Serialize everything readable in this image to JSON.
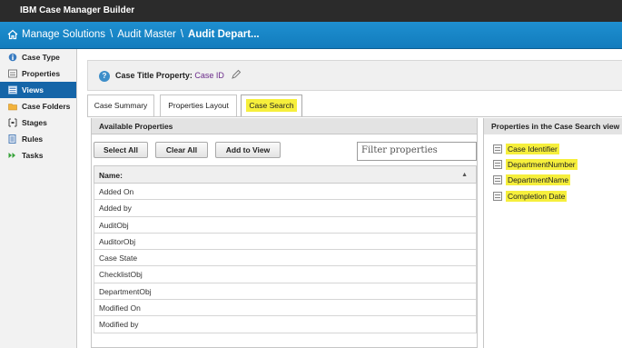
{
  "app": {
    "title": "IBM Case Manager Builder"
  },
  "breadcrumb": {
    "items": [
      "Manage Solutions",
      "Audit Master"
    ],
    "current": "Audit Depart...",
    "separator": "\\"
  },
  "sidebar": {
    "items": [
      {
        "label": "Case Type",
        "icon": "case-type-icon"
      },
      {
        "label": "Properties",
        "icon": "properties-icon"
      },
      {
        "label": "Views",
        "icon": "views-icon",
        "active": true
      },
      {
        "label": "Case Folders",
        "icon": "folder-icon"
      },
      {
        "label": "Stages",
        "icon": "stages-icon"
      },
      {
        "label": "Rules",
        "icon": "rules-icon"
      },
      {
        "label": "Tasks",
        "icon": "tasks-icon"
      }
    ]
  },
  "case_title": {
    "label": "Case Title Property:",
    "value": "Case ID"
  },
  "tabs": [
    {
      "label": "Case Summary"
    },
    {
      "label": "Properties Layout"
    },
    {
      "label": "Case Search",
      "active": true
    }
  ],
  "available": {
    "header": "Available Properties",
    "select_all": "Select All",
    "clear_all": "Clear All",
    "add_to_view": "Add to View",
    "filter_placeholder": "Filter properties",
    "column_name": "Name:",
    "rows": [
      "Added On",
      "Added by",
      "AuditObj",
      "AuditorObj",
      "Case State",
      "ChecklistObj",
      "DepartmentObj",
      "Modified On",
      "Modified by"
    ]
  },
  "search_view": {
    "header": "Properties in the Case Search view",
    "items": [
      "Case Identifier",
      "DepartmentNumber",
      "DepartmentName",
      "Completion Date"
    ]
  },
  "colors": {
    "topbar": "#2b2b2b",
    "breadcrumb": "#1a86c8",
    "active_nav": "#1565a8",
    "highlight": "#f6ef3c"
  }
}
